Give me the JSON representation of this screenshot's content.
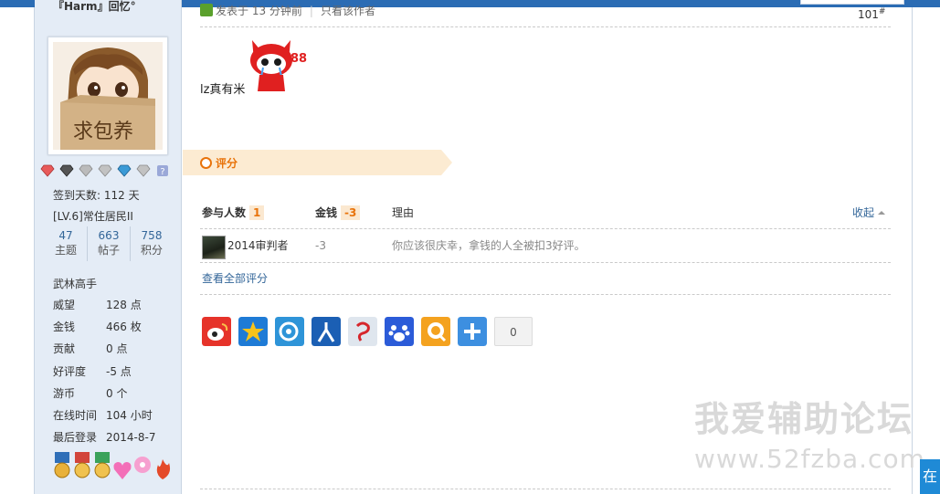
{
  "colors": {
    "accent_blue": "#2b6cb4",
    "link": "#336699",
    "rating_orange": "#e8730a",
    "sidebar_bg": "#e4ecf6"
  },
  "sidebar": {
    "username": "『Harm』回忆°",
    "checkin": "签到天数: 112 天",
    "level": "[LV.6]常住居民II",
    "counters": [
      {
        "num": "47",
        "label": "主题"
      },
      {
        "num": "663",
        "label": "帖子"
      },
      {
        "num": "758",
        "label": "积分"
      }
    ],
    "title": "武林高手",
    "stats": [
      {
        "k": "威望",
        "v": "128 点"
      },
      {
        "k": "金钱",
        "v": "466 枚"
      },
      {
        "k": "贡献",
        "v": "0 点"
      },
      {
        "k": "好评度",
        "v": "-5 点"
      },
      {
        "k": "游币",
        "v": "0 个"
      },
      {
        "k": "在线时间",
        "v": "104 小时"
      },
      {
        "k": "最后登录",
        "v": "2014-8-7"
      }
    ]
  },
  "post": {
    "posted": "发表于 13 分钟前",
    "only_author": "只看该作者",
    "floor": "101",
    "floor_mark": "#",
    "text": "lz真有米"
  },
  "rating": {
    "title": "评分",
    "col_people": "参与人数",
    "people_count": "1",
    "col_money": "金钱",
    "money_total": "-3",
    "col_reason": "理由",
    "collapse": "收起",
    "rows": [
      {
        "name": "2014审判者",
        "score": "-3",
        "reason": "你应该很庆幸，拿钱的人全被扣3好评。"
      }
    ],
    "view_all": "查看全部评分"
  },
  "share": {
    "icons": [
      "weibo-icon",
      "qzone-icon",
      "tencent-weibo-icon",
      "renren-icon",
      "netease-weibo-icon",
      "baidu-icon",
      "qq-icon",
      "more-share-icon"
    ],
    "count": "0"
  },
  "watermark": {
    "line1": "我爱辅助论坛",
    "line2": "www.52fzba.com"
  },
  "corner_tab": "在"
}
